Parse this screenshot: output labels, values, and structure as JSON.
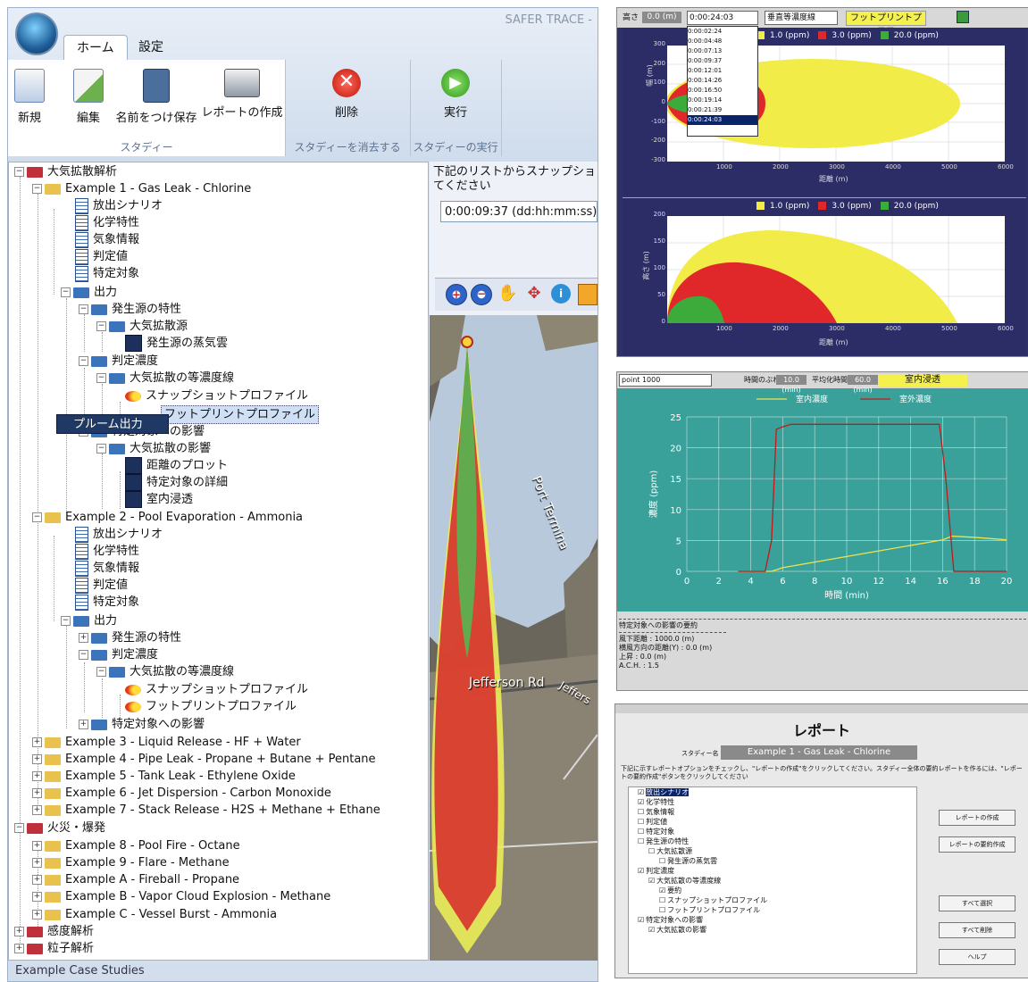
{
  "app": {
    "title": "SAFER TRACE -",
    "tabs": [
      "ホーム",
      "設定"
    ],
    "buttons": {
      "new": "新規",
      "edit": "編集",
      "save_as": "名前をつけ保存",
      "report": "レポートの作成",
      "delete": "削除",
      "run": "実行"
    },
    "groups": {
      "study": "スタディー",
      "clear": "スタディーを消去する",
      "run": "スタディーの実行"
    },
    "status": "Example Case Studies"
  },
  "tree": {
    "root1": "大気拡散解析",
    "ex1": "Example 1 - Gas Leak - Chlorine",
    "scenario": "放出シナリオ",
    "chem": "化学特性",
    "weather": "気象情報",
    "judge": "判定値",
    "target": "特定対象",
    "output": "出力",
    "source_props": "発生源の特性",
    "atm_source": "大気拡散源",
    "vapor_cloud": "発生源の蒸気雲",
    "conc": "判定濃度",
    "isopleth": "大気拡散の等濃度線",
    "snapshot": "スナップショットプロファイル",
    "footprint": "フットプリントプロファイル",
    "impact": "特定対象への影響",
    "atm_impact": "大気拡散の影響",
    "dist_plot": "距離のプロット",
    "target_detail": "特定対象の詳細",
    "indoor": "室内浸透",
    "ex2": "Example 2 - Pool Evaporation - Ammonia",
    "ex3": "Example 3 - Liquid Release - HF + Water",
    "ex4": "Example 4 - Pipe Leak - Propane + Butane + Pentane",
    "ex5": "Example 5 - Tank Leak - Ethylene Oxide",
    "ex6": "Example 6 - Jet Dispersion - Carbon Monoxide",
    "ex7": "Example 7 - Stack Release - H2S + Methane + Ethane",
    "root2": "火災・爆発",
    "ex8": "Example 8 - Pool Fire - Octane",
    "ex9": "Example 9 - Flare - Methane",
    "exA": "Example A - Fireball - Propane",
    "exB": "Example B - Vapor Cloud Explosion - Methane",
    "exC": "Example C - Vessel Burst - Ammonia",
    "root3": "感度解析",
    "root4": "粒子解析",
    "popup": "プルーム出力"
  },
  "snapshot": {
    "prompt": "下記のリストからスナップショット時",
    "prompt2": "てください",
    "selected": "0:00:09:37 (dd:hh:mm:ss)",
    "map_labels": [
      "Jefferson Rd",
      "Jeffers",
      "Port Termina"
    ]
  },
  "plot1": {
    "toolbar": {
      "height_label": "高さ",
      "height_value": "0.0 (m)",
      "time": "0:00:24:03",
      "mode": "垂直等濃度線",
      "tab": "フットプリントプロフ"
    },
    "times": [
      "0:00:02:24",
      "0:00:04:48",
      "0:00:07:13",
      "0:00:09:37",
      "0:00:12:01",
      "0:00:14:26",
      "0:00:16:50",
      "0:00:19:14",
      "0:00:21:39",
      "0:00:24:03"
    ],
    "legend": [
      "1.0 (ppm)",
      "3.0 (ppm)",
      "20.0 (ppm)"
    ],
    "top_ylabel": "幅 (m)",
    "bottom_ylabel": "高さ (m)",
    "xlabel": "距離 (m)",
    "top_yticks": [
      "300",
      "200",
      "100",
      "0",
      "-100",
      "-200",
      "-300"
    ],
    "bottom_yticks": [
      "200",
      "150",
      "100",
      "50",
      "0"
    ],
    "xticks": [
      "1000",
      "2000",
      "3000",
      "4000",
      "5000",
      "6000"
    ]
  },
  "plot2": {
    "toolbar": {
      "point": "point 1000",
      "time_label": "時間のぶれ",
      "time_value": "10.0 (min)",
      "avg_label": "平均化時間",
      "avg_value": "60.0 (min)",
      "tab": "室内浸透"
    },
    "summary_title": "特定対象への影響の要約",
    "summary_lines": [
      "風下距離 :  1000.0 (m)",
      "横風方向の距離(Y) :  0.0 (m)",
      "上昇 :  0.0 (m)",
      "A.C.H. :  1.5"
    ]
  },
  "report": {
    "title": "レポート",
    "study_label": "スタディー名",
    "study_name": "Example 1 - Gas Leak - Chlorine",
    "instructions": "下記に示すレポートオプションをチェックし、\"レポートの作成\"をクリックしてください。スタディー全体の要約レポートを作るには、\"レポートの要約作成\"ボタンをクリックしてください",
    "items": [
      "放出シナリオ",
      "化学特性",
      "気象情報",
      "判定値",
      "特定対象",
      "発生源の特性",
      "大気拡散源",
      "発生源の蒸気雲",
      "判定濃度",
      "大気拡散の等濃度線",
      "要約",
      "スナップショットプロファイル",
      "フットプリントプロファイル",
      "特定対象への影響",
      "大気拡散の影響"
    ],
    "buttons": [
      "レポートの作成",
      "レポートの要約作成",
      "すべて選択",
      "すべて削除",
      "ヘルプ"
    ]
  },
  "chart_data": {
    "type": "line",
    "xlabel": "時間 (min)",
    "ylabel": "濃度 (ppm)",
    "xlim": [
      0,
      20
    ],
    "ylim": [
      0,
      25
    ],
    "xticks": [
      0,
      2,
      4,
      6,
      8,
      10,
      12,
      14,
      16,
      18,
      20
    ],
    "yticks": [
      0,
      5,
      10,
      15,
      20,
      25
    ],
    "series": [
      {
        "name": "室内濃度",
        "color": "#f0e24a",
        "x": [
          3.2,
          5.3,
          6,
          8,
          10,
          12,
          14,
          16,
          16.6,
          18,
          20
        ],
        "y": [
          0,
          0,
          0.6,
          1.5,
          2.4,
          3.3,
          4.2,
          5.1,
          5.7,
          5.5,
          5.1
        ]
      },
      {
        "name": "室外濃度",
        "color": "#c01a1a",
        "x": [
          3.2,
          4.9,
          5.3,
          5.6,
          6,
          6.5,
          10,
          15,
          15.8,
          16.2,
          16.7,
          20
        ],
        "y": [
          0,
          0,
          5,
          23,
          23.4,
          23.8,
          23.8,
          23.8,
          23.8,
          15,
          0,
          0
        ]
      }
    ]
  }
}
